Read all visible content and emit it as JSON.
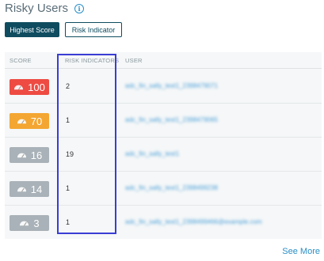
{
  "header": {
    "title": "Risky Users",
    "info_icon": "info-icon"
  },
  "tabs": {
    "highest_score": "Highest Score",
    "risk_indicator": "Risk Indicator"
  },
  "table": {
    "columns": [
      "SCORE",
      "RISK INDICATORS",
      "USER"
    ],
    "rows": [
      {
        "score": "100",
        "risk_indicators": "2",
        "user": "adc_fin_sally_test1_2398479071",
        "color": "#ee4b43"
      },
      {
        "score": "70",
        "risk_indicators": "1",
        "user": "adc_fin_sally_test1_2398479065",
        "color": "#f4a632"
      },
      {
        "score": "16",
        "risk_indicators": "19",
        "user": "adc_fin_sally_test1",
        "color": "#a9b2b8"
      },
      {
        "score": "14",
        "risk_indicators": "1",
        "user": "adc_fin_sally_test1_2398499238",
        "color": "#a9b2b8"
      },
      {
        "score": "3",
        "risk_indicators": "1",
        "user": "adc_fin_sally_test1_2398499466@example.com",
        "color": "#a9b2b8"
      }
    ]
  },
  "footer": {
    "see_more": "See More"
  }
}
